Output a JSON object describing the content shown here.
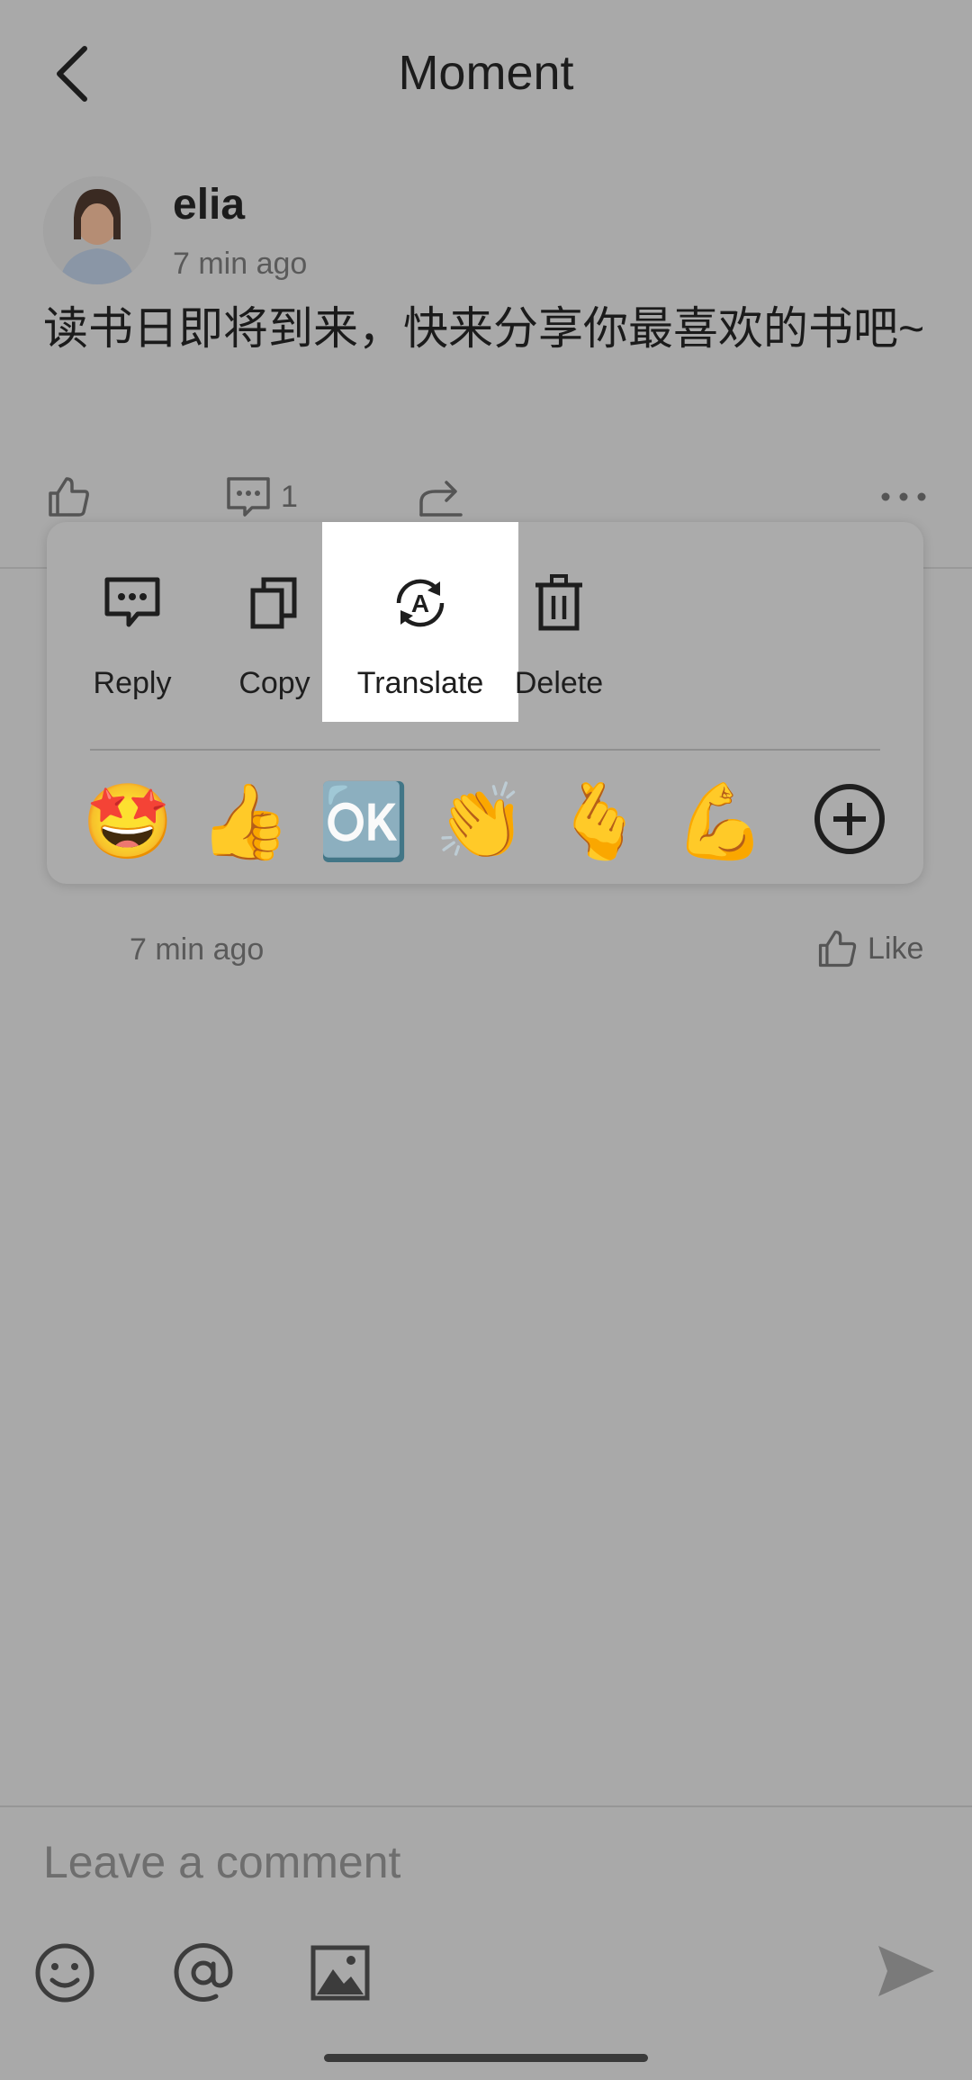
{
  "header": {
    "title": "Moment",
    "back_icon": "chevron-left-icon"
  },
  "post": {
    "author": "elia",
    "time": "7 min ago",
    "text": "读书日即将到来，快来分享你最喜欢的书吧~",
    "comment_count": "1"
  },
  "context_menu": {
    "items": [
      {
        "label": "Reply",
        "icon": "comment-icon"
      },
      {
        "label": "Copy",
        "icon": "copy-icon"
      },
      {
        "label": "Translate",
        "icon": "translate-icon"
      },
      {
        "label": "Delete",
        "icon": "trash-icon"
      }
    ],
    "reactions": [
      "🤩",
      "👍",
      "🆗",
      "👏",
      "🫰",
      "💪"
    ]
  },
  "comment": {
    "time": "7 min ago",
    "like_label": "Like"
  },
  "composer": {
    "placeholder": "Leave a comment"
  },
  "colors": {
    "overlay": "#a9a9a9",
    "highlight": "#ffffff",
    "ok_orange": "#e07b1a"
  }
}
